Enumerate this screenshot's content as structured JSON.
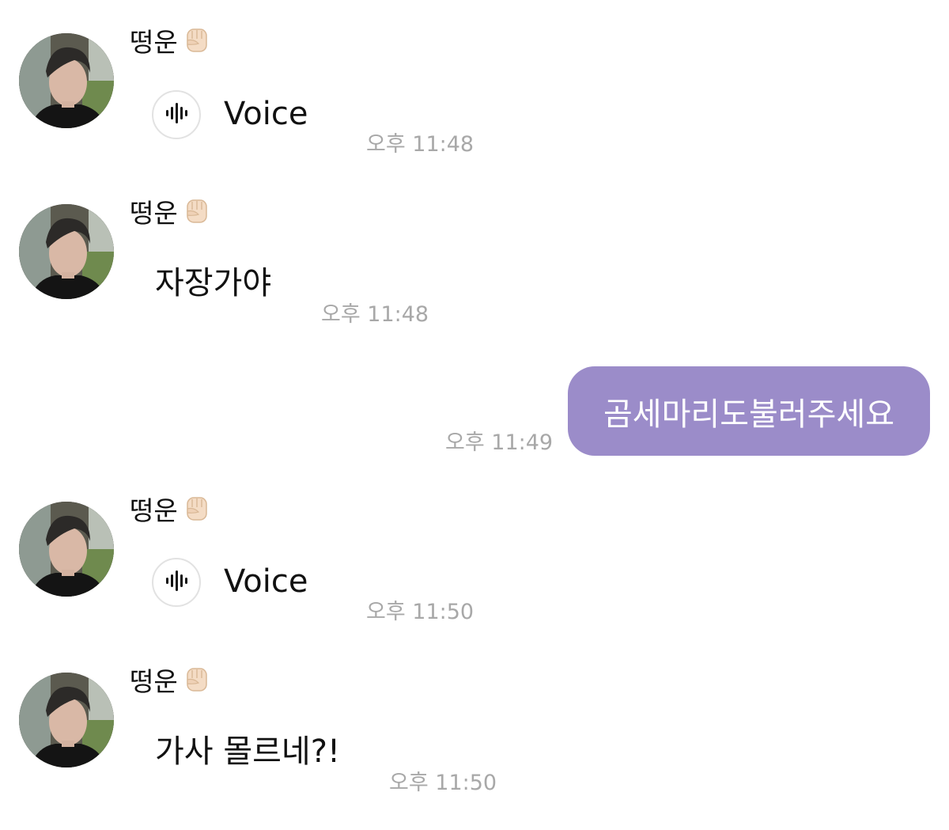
{
  "accent_color": "#9b8cc9",
  "messages": [
    {
      "type": "incoming-voice",
      "sender": "떵운",
      "sender_emoji": "fist-emoji",
      "label": "Voice",
      "time": "오후 11:48"
    },
    {
      "type": "incoming-text",
      "sender": "떵운",
      "sender_emoji": "fist-emoji",
      "text": "자장가야",
      "time": "오후 11:48"
    },
    {
      "type": "outgoing-text",
      "text": "곰세마리도불러주세요",
      "time": "오후 11:49"
    },
    {
      "type": "incoming-voice",
      "sender": "떵운",
      "sender_emoji": "fist-emoji",
      "label": "Voice",
      "time": "오후 11:50"
    },
    {
      "type": "incoming-text",
      "sender": "떵운",
      "sender_emoji": "fist-emoji",
      "text": "가사 몰르네?!",
      "time": "오후 11:50"
    }
  ]
}
